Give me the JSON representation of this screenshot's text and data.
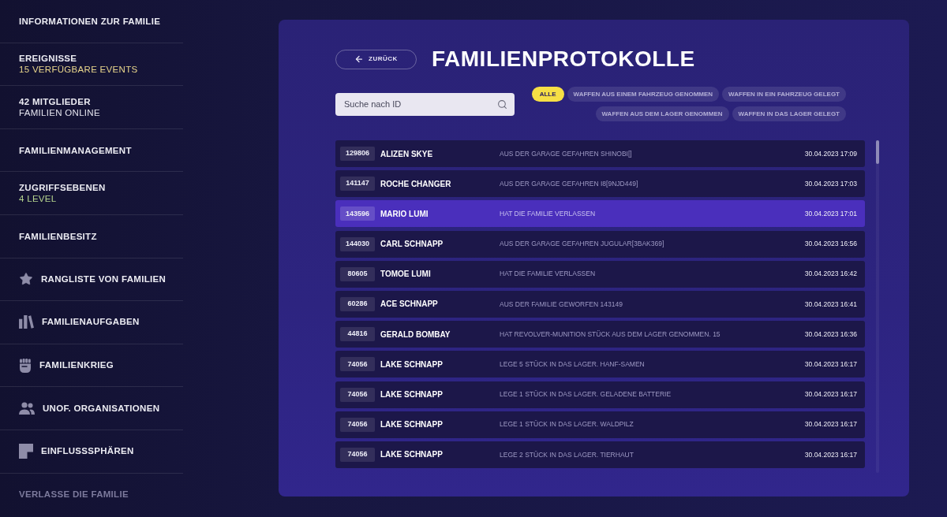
{
  "sidebar": {
    "info_items": [
      {
        "label": "INFORMATIONEN ZUR FAMILIE"
      },
      {
        "label": "EREIGNISSE",
        "subtitle": "15 VERFÜGBARE EVENTS",
        "color": "#e9d68c"
      },
      {
        "label": "42 MITGLIEDER",
        "subtitle": "FAMILIEN ONLINE",
        "color": "#e4e4ee"
      },
      {
        "label": "FAMILIENMANAGEMENT"
      },
      {
        "label": "ZUGRIFFSEBENEN",
        "subtitle": "4 LEVEL",
        "color": "#b7d68f"
      },
      {
        "label": "FAMILIENBESITZ"
      }
    ],
    "menu_items": [
      {
        "label": "RANGLISTE VON FAMILIEN"
      },
      {
        "label": "FAMILIENAUFGABEN"
      },
      {
        "label": "FAMILIENKRIEG"
      },
      {
        "label": "UNOF. ORGANISATIONEN"
      },
      {
        "label": "EINFLUSSSPHÄREN"
      }
    ],
    "leave_link": "VERLASSE DIE FAMILIE"
  },
  "header": {
    "back_button": "ZURÜCK",
    "title": "FAMILIENPROTOKOLLE"
  },
  "search": {
    "placeholder": "Suche nach ID"
  },
  "filters": [
    {
      "label": "ALLE",
      "selected": true
    },
    {
      "label": "WAFFEN AUS EINEM FAHRZEUG GENOMMEN",
      "selected": false
    },
    {
      "label": "WAFFEN IN EIN FAHRZEUG GELEGT",
      "selected": false
    },
    {
      "label": "WAFFEN AUS DEM LAGER GENOMMEN",
      "selected": false
    },
    {
      "label": "WAFFEN IN DAS LAGER GELEGT",
      "selected": false
    }
  ],
  "log": {
    "rows": [
      {
        "id": "129806",
        "name": "ALIZEN SKYE",
        "action": "AUS DER GARAGE GEFAHREN SHINOBI[]",
        "time": "30.04.2023 17:09",
        "selected": false
      },
      {
        "id": "141147",
        "name": "ROCHE CHANGER",
        "action": "AUS DER GARAGE GEFAHREN I8[9NJD449]",
        "time": "30.04.2023 17:03",
        "selected": false
      },
      {
        "id": "143596",
        "name": "MARIO LUMI",
        "action": "HAT DIE FAMILIE VERLASSEN",
        "time": "30.04.2023 17:01",
        "selected": true
      },
      {
        "id": "144030",
        "name": "CARL SCHNAPP",
        "action": "AUS DER GARAGE GEFAHREN JUGULAR[3BAK369]",
        "time": "30.04.2023 16:56",
        "selected": false
      },
      {
        "id": "80605",
        "name": "TOMOE LUMI",
        "action": "HAT DIE FAMILIE VERLASSEN",
        "time": "30.04.2023 16:42",
        "selected": false
      },
      {
        "id": "60286",
        "name": "ACE SCHNAPP",
        "action": "AUS DER FAMILIE GEWORFEN 143149",
        "time": "30.04.2023 16:41",
        "selected": false
      },
      {
        "id": "44816",
        "name": "GERALD BOMBAY",
        "action": "HAT REVOLVER-MUNITION STÜCK AUS DEM LAGER GENOMMEN. 15",
        "time": "30.04.2023 16:36",
        "selected": false
      },
      {
        "id": "74056",
        "name": "LAKE SCHNAPP",
        "action": "LEGE 5 STÜCK IN DAS LAGER. HANF-SAMEN",
        "time": "30.04.2023 16:17",
        "selected": false
      },
      {
        "id": "74056",
        "name": "LAKE SCHNAPP",
        "action": "LEGE 1 STÜCK IN DAS LAGER. GELADENE BATTERIE",
        "time": "30.04.2023 16:17",
        "selected": false
      },
      {
        "id": "74056",
        "name": "LAKE SCHNAPP",
        "action": "LEGE 1 STÜCK IN DAS LAGER. WALDPILZ",
        "time": "30.04.2023 16:17",
        "selected": false
      },
      {
        "id": "74056",
        "name": "LAKE SCHNAPP",
        "action": "LEGE 2 STÜCK IN DAS LAGER. TIERHAUT",
        "time": "30.04.2023 16:17",
        "selected": false
      }
    ]
  }
}
